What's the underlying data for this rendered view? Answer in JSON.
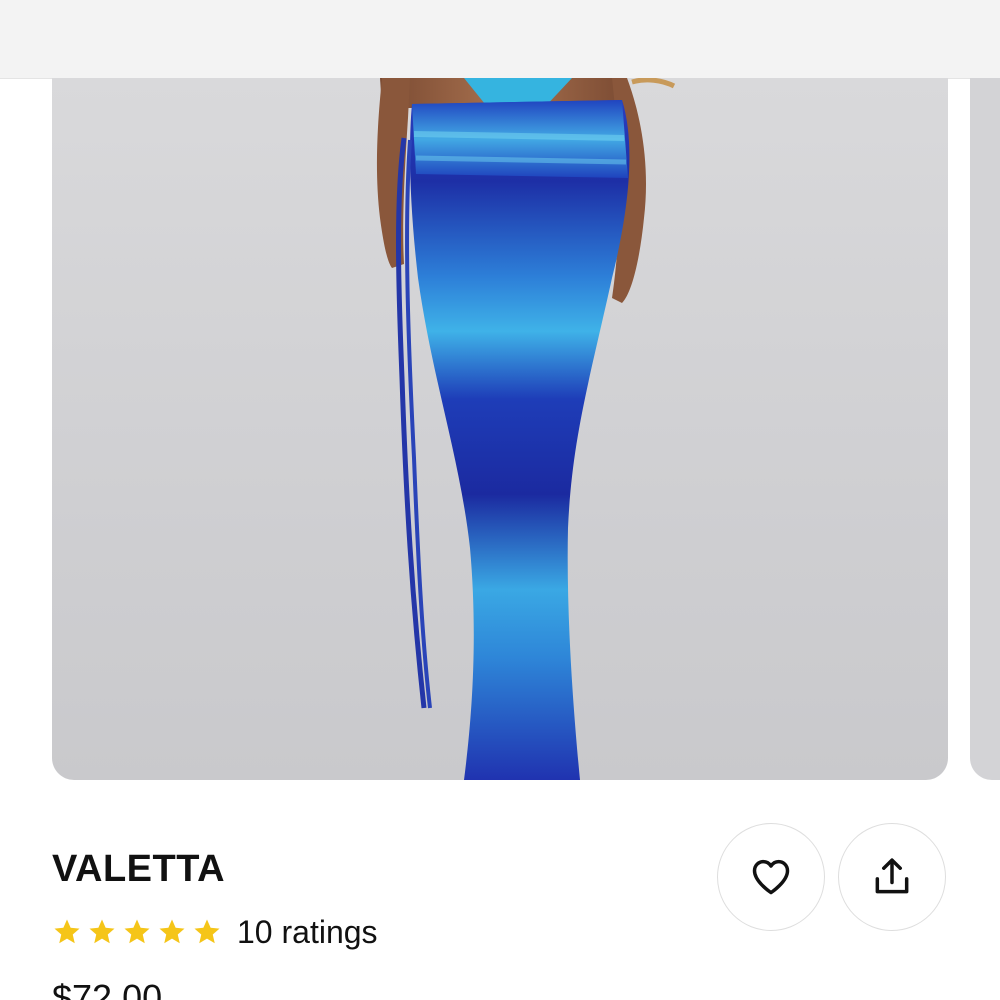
{
  "product": {
    "brand": "VALETTA",
    "rating": {
      "stars": 5,
      "label": "10 ratings",
      "star_color": "#f5c518"
    },
    "price": "$72.00"
  },
  "gallery": {
    "image_alt": "Blue ombre mesh maxi skirt with tie waist"
  },
  "actions": {
    "favorite_icon": "heart-icon",
    "share_icon": "share-icon"
  },
  "colors": {
    "skirt_dark": "#1f2fa8",
    "skirt_light": "#3fb4e6",
    "background": "#d3d3d6"
  }
}
